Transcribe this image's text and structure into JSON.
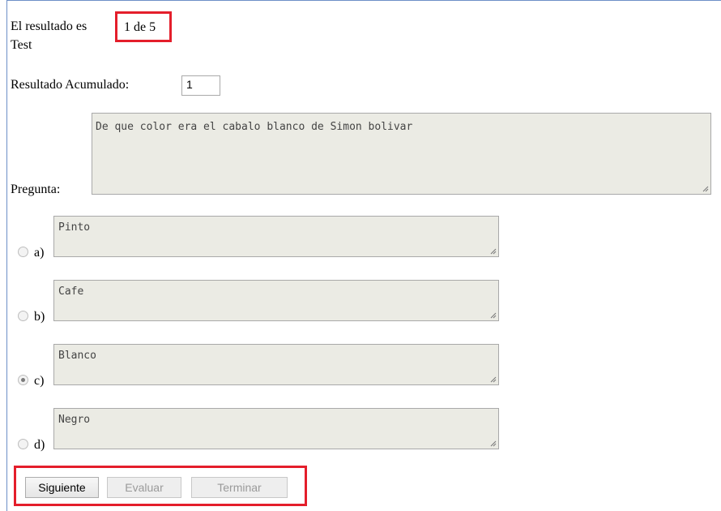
{
  "result": {
    "label": "El resultado es",
    "value": "1 de 5",
    "test_name": "Test"
  },
  "accumulated": {
    "label": "Resultado Acumulado:",
    "value": "1"
  },
  "question": {
    "label": "Pregunta:",
    "text": "De que color era el cabalo blanco de Simon bolivar"
  },
  "options": [
    {
      "letter": "a)",
      "text": "Pinto",
      "checked": false
    },
    {
      "letter": "b)",
      "text": "Cafe",
      "checked": false
    },
    {
      "letter": "c)",
      "text": "Blanco",
      "checked": true
    },
    {
      "letter": "d)",
      "text": "Negro",
      "checked": false
    }
  ],
  "buttons": {
    "next": "Siguiente",
    "evaluate": "Evaluar",
    "finish": "Terminar"
  },
  "colors": {
    "highlight_border": "#e41e2b",
    "disabled_textarea": "#ebebe4",
    "frame_border": "#6d8fc7"
  },
  "icons": {
    "resize_handle": "resize-grip-icon",
    "radio": "radio-button"
  }
}
